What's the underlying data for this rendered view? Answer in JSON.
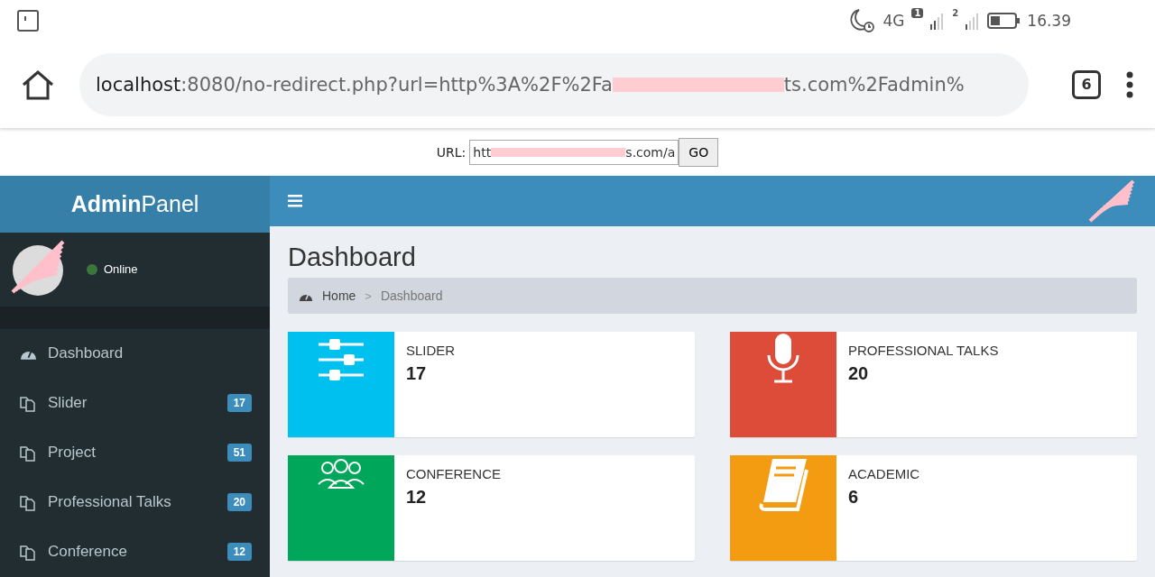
{
  "status_bar": {
    "network": "4G",
    "sim1": "1",
    "sim2": "2",
    "time": "16.39"
  },
  "browser": {
    "url_host": "localhost",
    "url_rest": ":8080/no-redirect.php?url=http%3A%2F%2Fa",
    "url_tail": "ts.com%2Fadmin%",
    "tab_count": "6"
  },
  "proxy_form": {
    "label": "URL:",
    "value_start": "htt",
    "value_end": "s.com/a",
    "button": "GO"
  },
  "app": {
    "logo_bold": "Admin",
    "logo_light": "Panel"
  },
  "user_panel": {
    "status": "Online"
  },
  "sidebar": {
    "items": [
      {
        "label": "Dashboard",
        "kind": "dashboard",
        "selected": false
      },
      {
        "label": "Slider",
        "kind": "pages",
        "badge": "17",
        "selected": false
      },
      {
        "label": "Project",
        "kind": "pages",
        "badge": "51",
        "selected": false
      },
      {
        "label": "Professional Talks",
        "kind": "pages",
        "badge": "20",
        "selected": false
      },
      {
        "label": "Conference",
        "kind": "pages",
        "badge": "12",
        "selected": false
      }
    ]
  },
  "content": {
    "title": "Dashboard",
    "breadcrumb": [
      {
        "label": "Home",
        "kind": "link"
      },
      {
        "label": ">",
        "kind": "separator"
      },
      {
        "label": "Dashboard",
        "kind": "current"
      }
    ],
    "cards": [
      {
        "label": "SLIDER",
        "value": "17",
        "kind": "sliders",
        "color": "#00c0ef"
      },
      {
        "label": "PROFESSIONAL TALKS",
        "value": "20",
        "kind": "microphone",
        "color": "#dd4b39"
      },
      {
        "label": "CONFERENCE",
        "value": "12",
        "kind": "people",
        "color": "#00a65a"
      },
      {
        "label": "ACADEMIC",
        "value": "6",
        "kind": "book",
        "color": "#f39c12"
      }
    ]
  }
}
